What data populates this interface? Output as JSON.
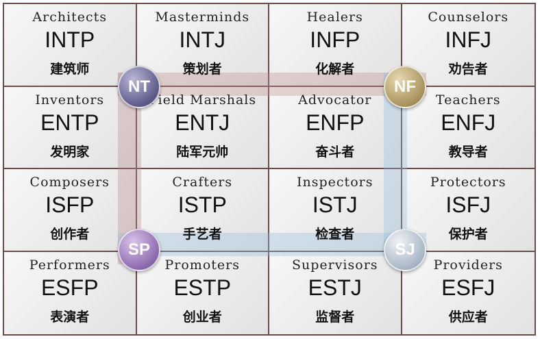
{
  "cells": [
    {
      "role": "Architects",
      "code": "INTP",
      "cn": "建筑师"
    },
    {
      "role": "Masterminds",
      "code": "INTJ",
      "cn": "策划者"
    },
    {
      "role": "Healers",
      "code": "INFP",
      "cn": "化解者"
    },
    {
      "role": "Counselors",
      "code": "INFJ",
      "cn": "劝告者"
    },
    {
      "role": "Inventors",
      "code": "ENTP",
      "cn": "发明家"
    },
    {
      "role": "Field Marshals",
      "code": "ENTJ",
      "cn": "陆军元帅"
    },
    {
      "role": "Advocator",
      "code": "ENFP",
      "cn": "奋斗者"
    },
    {
      "role": "Teachers",
      "code": "ENFJ",
      "cn": "教导者"
    },
    {
      "role": "Composers",
      "code": "ISFP",
      "cn": "创作者"
    },
    {
      "role": "Crafters",
      "code": "ISTP",
      "cn": "手艺者"
    },
    {
      "role": "Inspectors",
      "code": "ISTJ",
      "cn": "检查者"
    },
    {
      "role": "Protectors",
      "code": "ISFJ",
      "cn": "保护者"
    },
    {
      "role": "Performers",
      "code": "ESFP",
      "cn": "表演者"
    },
    {
      "role": "Promoters",
      "code": "ESTP",
      "cn": "创业者"
    },
    {
      "role": "Supervisors",
      "code": "ESTJ",
      "cn": "监督者"
    },
    {
      "role": "Providers",
      "code": "ESFJ",
      "cn": "供应者"
    }
  ],
  "badges": {
    "nt": "NT",
    "nf": "NF",
    "sp": "SP",
    "sj": "SJ"
  },
  "colors": {
    "nt": "#5e5b8a",
    "nf": "#a8935d",
    "sp": "#8e6bb0",
    "sj": "#a9b7c6",
    "border": "#6b4a4a",
    "band_warm": "#be8c8c",
    "band_cool": "#96bedc"
  }
}
